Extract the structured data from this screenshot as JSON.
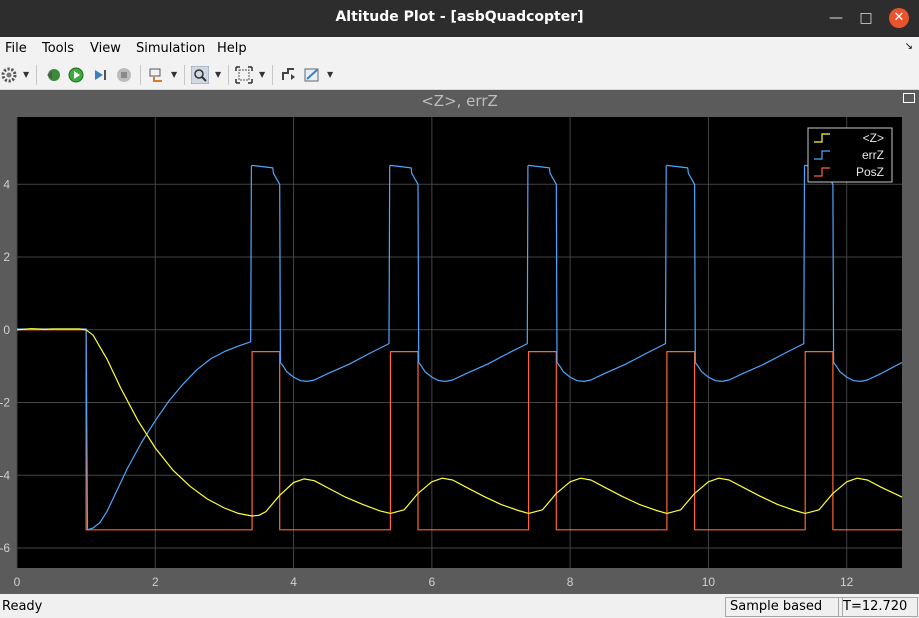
{
  "window": {
    "title": "Altitude Plot - [asbQuadcopter]"
  },
  "menu": {
    "items": [
      "File",
      "Tools",
      "View",
      "Simulation",
      "Help"
    ]
  },
  "toolbar": {
    "icons": [
      "gear-icon",
      "step-back-icon",
      "run-icon",
      "step-forward-icon",
      "stop-icon",
      "signal-select-icon",
      "zoom-icon",
      "fit-axes-icon",
      "trigger-icon",
      "style-icon"
    ]
  },
  "plot": {
    "title": "<Z>, errZ",
    "background": "#000000",
    "grid_color": "#444444",
    "tick_color": "#d0d0d0"
  },
  "status": {
    "ready": "Ready",
    "mode": "Sample based",
    "time": "T=12.720"
  },
  "chart_data": {
    "type": "line",
    "title": "<Z>, errZ",
    "xlim": [
      0,
      12.8
    ],
    "ylim": [
      -6.55,
      5.85
    ],
    "xticks": [
      "0",
      "2",
      "4",
      "6",
      "8",
      "10",
      "12"
    ],
    "yticks": [
      {
        "value": 4,
        "label": "4"
      },
      {
        "value": 2,
        "label": "2"
      },
      {
        "value": 0,
        "label": "0"
      },
      {
        "value": -2,
        "label": "-2"
      },
      {
        "value": -4,
        "label": "-4"
      },
      {
        "value": -6,
        "label": "-6"
      }
    ],
    "grid": true,
    "legend_position": "top-right",
    "series": [
      {
        "name": "<Z>",
        "color": "#ffff33",
        "x": [
          0,
          0.1,
          0.2,
          0.3,
          0.4,
          0.5,
          0.6,
          0.7,
          0.8,
          0.9,
          1.0,
          1.1,
          1.3,
          1.5,
          1.75,
          2.0,
          2.25,
          2.5,
          2.75,
          3.0,
          3.2,
          3.4,
          3.5,
          3.6,
          3.8,
          4.0,
          4.15,
          4.3,
          4.5,
          4.75,
          5.0,
          5.25,
          5.4,
          5.6,
          5.8,
          6.0,
          6.15,
          6.3,
          6.5,
          6.75,
          7.0,
          7.25,
          7.4,
          7.6,
          7.8,
          8.0,
          8.15,
          8.3,
          8.5,
          8.75,
          9.0,
          9.25,
          9.4,
          9.6,
          9.8,
          10.0,
          10.15,
          10.3,
          10.5,
          10.75,
          11.0,
          11.25,
          11.4,
          11.6,
          11.8,
          12.0,
          12.15,
          12.3,
          12.5,
          12.8
        ],
        "y": [
          0,
          0.01,
          0.03,
          0.02,
          0.01,
          0.02,
          0.02,
          0.02,
          0.02,
          0.02,
          0,
          -0.15,
          -0.8,
          -1.6,
          -2.5,
          -3.25,
          -3.85,
          -4.3,
          -4.65,
          -4.9,
          -5.05,
          -5.12,
          -5.1,
          -5.0,
          -4.55,
          -4.2,
          -4.1,
          -4.15,
          -4.35,
          -4.6,
          -4.8,
          -4.98,
          -5.05,
          -4.95,
          -4.5,
          -4.18,
          -4.08,
          -4.13,
          -4.33,
          -4.58,
          -4.8,
          -4.97,
          -5.05,
          -4.95,
          -4.5,
          -4.18,
          -4.08,
          -4.13,
          -4.33,
          -4.58,
          -4.8,
          -4.97,
          -5.05,
          -4.95,
          -4.5,
          -4.18,
          -4.08,
          -4.13,
          -4.33,
          -4.58,
          -4.8,
          -4.97,
          -5.05,
          -4.95,
          -4.5,
          -4.18,
          -4.08,
          -4.13,
          -4.33,
          -4.6
        ]
      },
      {
        "name": "errZ",
        "color": "#4da6ff",
        "x": [
          0,
          0.8,
          0.85,
          1.0,
          1.02,
          1.1,
          1.2,
          1.3,
          1.4,
          1.6,
          1.8,
          2.0,
          2.2,
          2.4,
          2.6,
          2.8,
          3.0,
          3.2,
          3.38,
          3.39,
          3.4,
          3.7,
          3.71,
          3.8,
          3.81,
          3.85,
          3.9,
          4.0,
          4.1,
          4.2,
          4.3,
          4.5,
          4.8,
          5.1,
          5.38,
          5.39,
          5.4,
          5.7,
          5.71,
          5.8,
          5.81,
          5.85,
          5.9,
          6.0,
          6.1,
          6.2,
          6.3,
          6.5,
          6.8,
          7.1,
          7.38,
          7.39,
          7.4,
          7.7,
          7.71,
          7.8,
          7.81,
          7.85,
          7.9,
          8.0,
          8.1,
          8.2,
          8.3,
          8.5,
          8.8,
          9.1,
          9.38,
          9.39,
          9.4,
          9.7,
          9.71,
          9.8,
          9.81,
          9.85,
          9.9,
          10.0,
          10.1,
          10.2,
          10.3,
          10.5,
          10.8,
          11.1,
          11.38,
          11.39,
          11.4,
          11.7,
          11.71,
          11.8,
          11.81,
          11.85,
          11.9,
          12.0,
          12.1,
          12.2,
          12.3,
          12.5,
          12.8
        ],
        "y": [
          0.02,
          0.02,
          0.02,
          0.02,
          -5.5,
          -5.45,
          -5.3,
          -5.0,
          -4.6,
          -3.8,
          -3.1,
          -2.5,
          -1.95,
          -1.5,
          -1.1,
          -0.8,
          -0.6,
          -0.45,
          -0.33,
          4.5,
          4.52,
          4.45,
          4.3,
          4.0,
          -0.9,
          -1.0,
          -1.15,
          -1.3,
          -1.4,
          -1.42,
          -1.38,
          -1.2,
          -0.95,
          -0.65,
          -0.38,
          4.5,
          4.52,
          4.45,
          4.3,
          4.0,
          -0.9,
          -1.0,
          -1.15,
          -1.3,
          -1.4,
          -1.42,
          -1.38,
          -1.2,
          -0.95,
          -0.65,
          -0.38,
          4.5,
          4.52,
          4.45,
          4.3,
          4.0,
          -0.9,
          -1.0,
          -1.15,
          -1.3,
          -1.4,
          -1.42,
          -1.38,
          -1.2,
          -0.95,
          -0.65,
          -0.38,
          4.5,
          4.52,
          4.45,
          4.3,
          4.0,
          -0.9,
          -1.0,
          -1.15,
          -1.3,
          -1.4,
          -1.42,
          -1.38,
          -1.2,
          -0.95,
          -0.65,
          -0.38,
          4.5,
          4.52,
          4.45,
          4.3,
          4.0,
          -0.9,
          -1.0,
          -1.15,
          -1.3,
          -1.4,
          -1.42,
          -1.38,
          -1.2,
          -0.9
        ]
      },
      {
        "name": "PosZ",
        "color": "#ff6633",
        "x": [
          0,
          1.0,
          1.0,
          3.4,
          3.4,
          3.8,
          3.8,
          5.4,
          5.4,
          5.8,
          5.8,
          7.4,
          7.4,
          7.8,
          7.8,
          9.4,
          9.4,
          9.8,
          9.8,
          11.4,
          11.4,
          11.8,
          11.8,
          12.8
        ],
        "y": [
          0,
          0,
          -5.5,
          -5.5,
          -0.6,
          -0.6,
          -5.5,
          -5.5,
          -0.6,
          -0.6,
          -5.5,
          -5.5,
          -0.6,
          -0.6,
          -5.5,
          -5.5,
          -0.6,
          -0.6,
          -5.5,
          -5.5,
          -0.6,
          -0.6,
          -5.5,
          -5.5
        ]
      }
    ]
  }
}
